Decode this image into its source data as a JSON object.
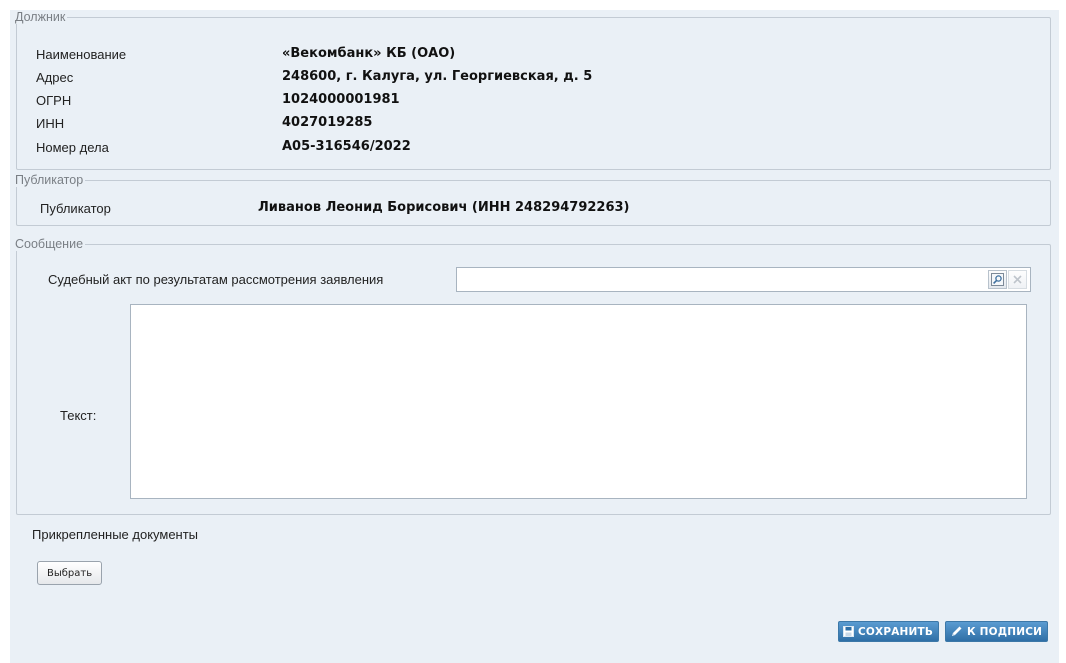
{
  "debtor": {
    "legend": "Должник",
    "rows": [
      {
        "label": "Наименование",
        "value": "«Векомбанк» КБ (ОАО)"
      },
      {
        "label": "Адрес",
        "value": "248600, г. Калуга, ул. Георгиевская, д. 5"
      },
      {
        "label": "ОГРН",
        "value": "1024000001981"
      },
      {
        "label": "ИНН",
        "value": "4027019285"
      },
      {
        "label": "Номер дела",
        "value": "А05-316546/2022"
      }
    ]
  },
  "publisher": {
    "legend": "Публикатор",
    "label": "Публикатор",
    "value": "Ливанов Леонид Борисович (ИНН 248294792263)"
  },
  "message": {
    "legend": "Сообщение",
    "court_act_label": "Судебный акт по результатам рассмотрения заявления",
    "court_act_value": "",
    "text_label": "Текст:",
    "text_value": ""
  },
  "attachments": {
    "label": "Прикрепленные документы",
    "choose_button": "Выбрать"
  },
  "actions": {
    "save_label": "СОХРАНИТЬ",
    "sign_label": "К ПОДПИСИ"
  },
  "colors": {
    "panel_bg": "#eaf0f6",
    "button_blue": "#3b7fb8"
  }
}
